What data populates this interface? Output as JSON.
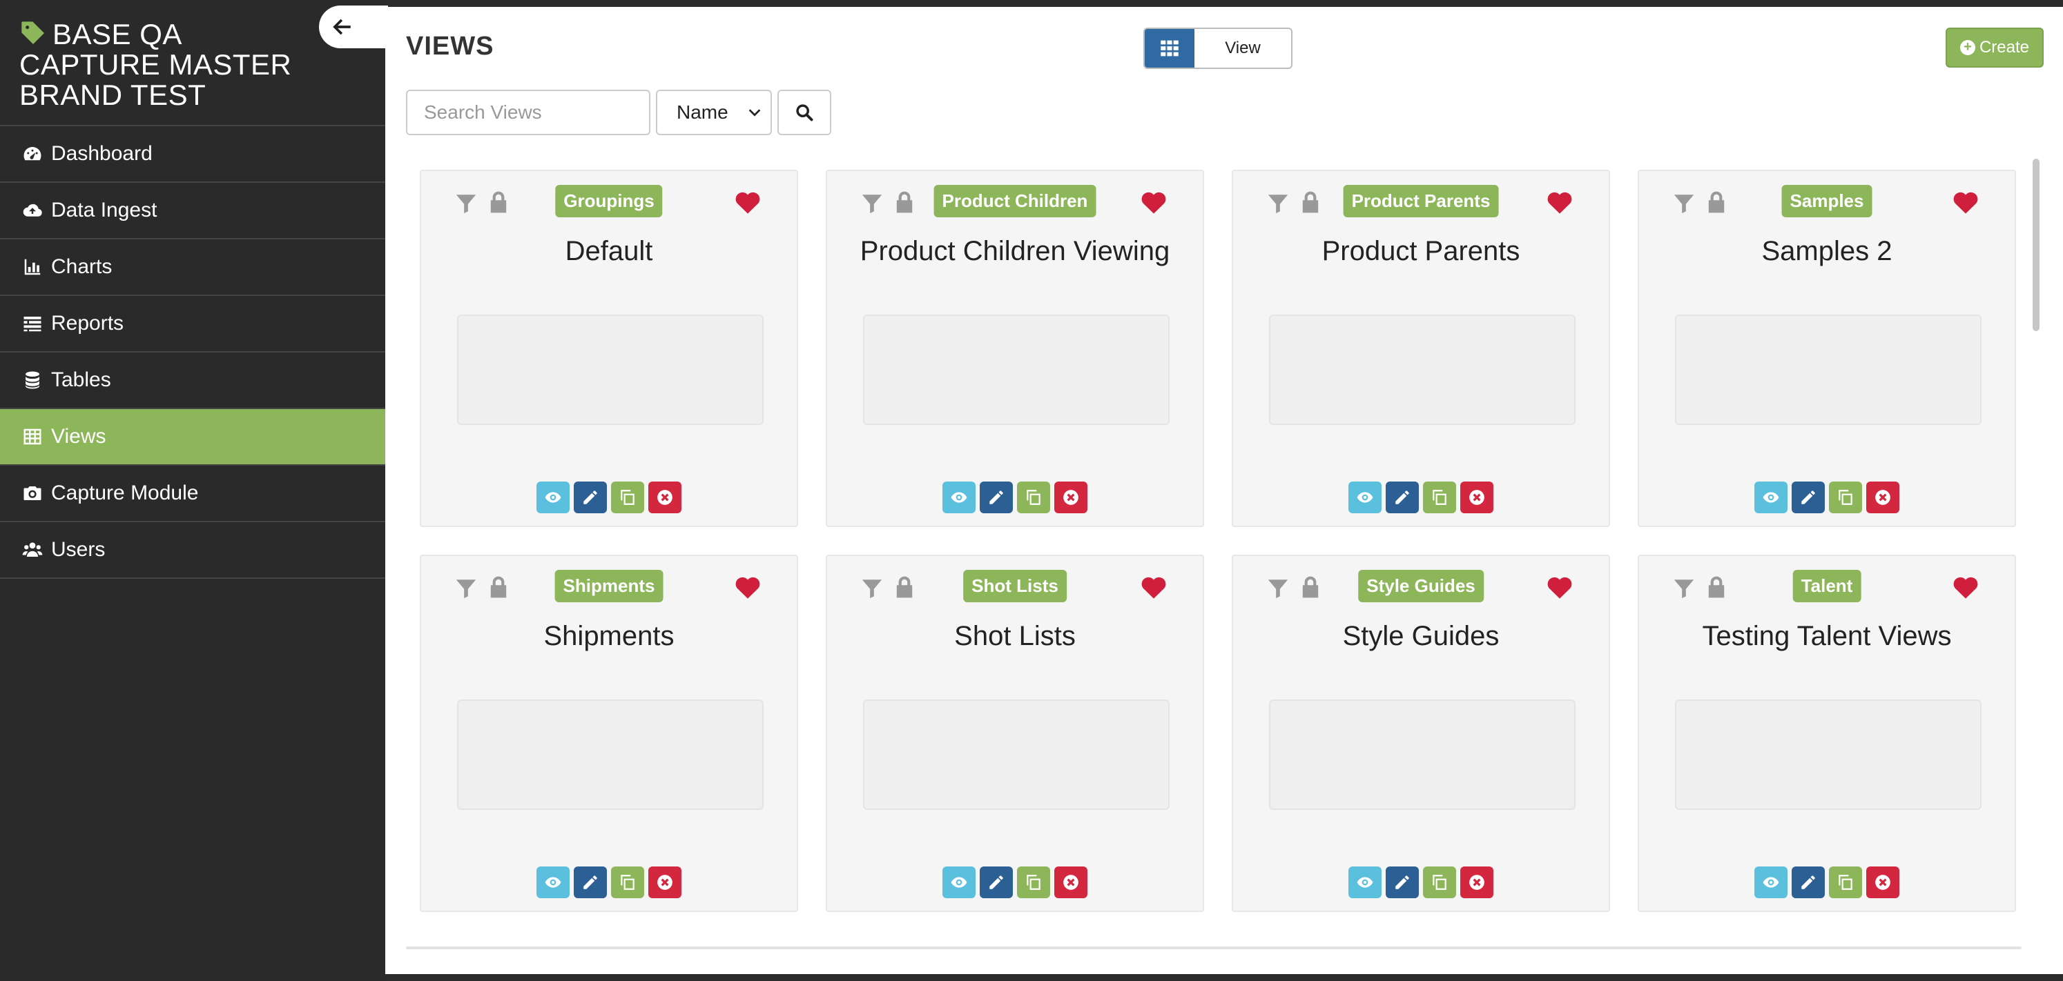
{
  "sidebar": {
    "brand": "BASE QA CAPTURE MASTER BRAND TEST",
    "items": [
      {
        "label": "Dashboard",
        "icon": "dashboard-icon"
      },
      {
        "label": "Data Ingest",
        "icon": "cloud-upload-icon"
      },
      {
        "label": "Charts",
        "icon": "bar-chart-icon"
      },
      {
        "label": "Reports",
        "icon": "report-icon"
      },
      {
        "label": "Tables",
        "icon": "database-icon"
      },
      {
        "label": "Views",
        "icon": "table-icon",
        "active": true
      },
      {
        "label": "Capture Module",
        "icon": "camera-icon"
      },
      {
        "label": "Users",
        "icon": "users-icon"
      }
    ]
  },
  "header": {
    "title": "VIEWS",
    "view_toggle_label": "View",
    "create_label": "Create"
  },
  "search": {
    "placeholder": "Search Views",
    "sort_value": "Name"
  },
  "colors": {
    "accent_green": "#8db65b",
    "primary_blue": "#2f6aa3",
    "favorite_red": "#d01f3c"
  },
  "cards": [
    {
      "tag": "Groupings",
      "title": "Default"
    },
    {
      "tag": "Product Children",
      "title": "Product Children Viewing"
    },
    {
      "tag": "Product Parents",
      "title": "Product Parents"
    },
    {
      "tag": "Samples",
      "title": "Samples 2"
    },
    {
      "tag": "Shipments",
      "title": "Shipments"
    },
    {
      "tag": "Shot Lists",
      "title": "Shot Lists"
    },
    {
      "tag": "Style Guides",
      "title": "Style Guides"
    },
    {
      "tag": "Talent",
      "title": "Testing Talent Views"
    }
  ]
}
